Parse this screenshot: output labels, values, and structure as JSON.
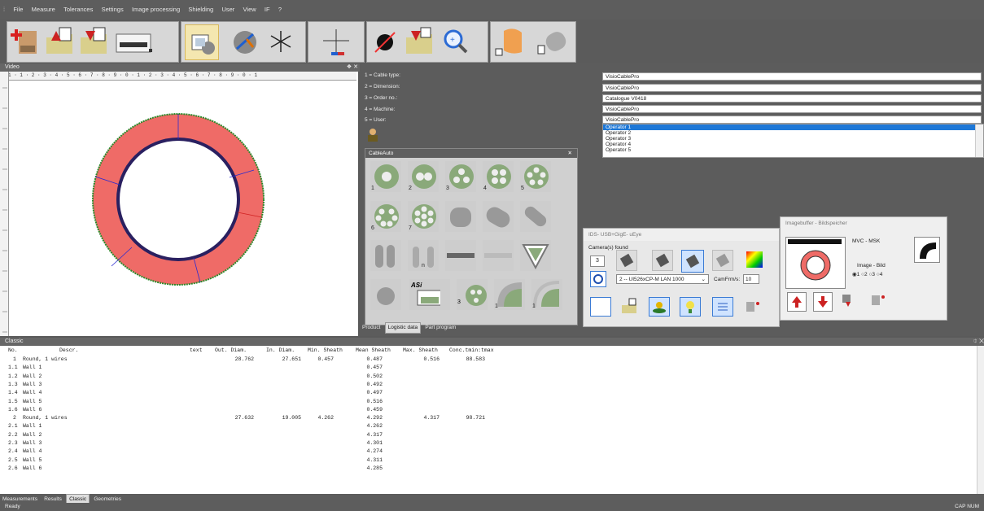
{
  "menu": [
    "File",
    "Measure",
    "Tolerances",
    "Settings",
    "Image processing",
    "Shielding",
    "User",
    "View",
    "IF",
    "?"
  ],
  "video": {
    "title": "Video",
    "pin": "❖ ✕",
    "ruler_top": "1 · 1 · 2 · 3 · 4 · 5 · 6 · 7 · 8 · 9 · 0 · 1 · 2 · 3 · 4 · 5 · 6 · 7 · 8 · 9 · 0 · 1"
  },
  "form": {
    "labels": [
      "1 = Cable type:",
      "2 = Dimension:",
      "3 = Order no.:",
      "4 = Machine:",
      "5 = User:"
    ],
    "values": [
      "VisioCablePro",
      "VisioCablePro",
      "Catalogue V0418",
      "VisioCablePro",
      "VisioCablePro"
    ],
    "operators": [
      "Operator 1",
      "Operator 2",
      "Operator 3",
      "Operator 4",
      "Operator 5"
    ]
  },
  "cableauto": {
    "title": "CableAuto",
    "close": "✕",
    "labels": [
      "1",
      "2",
      "3",
      "4",
      "5",
      "6",
      "7",
      "n",
      "1",
      "1"
    ]
  },
  "tabs": [
    "Product",
    "Logistic data",
    "Part program"
  ],
  "ids": {
    "title": "IDS- USB+GigE- uEye",
    "found_label": "Camera(s) found",
    "count": "3",
    "camera": "2 -- UI526xCP-M LAN 1000",
    "camfrm_label": "CamFrm/s:",
    "camfrm_value": "10"
  },
  "imgbuf": {
    "title": "Imagebuffer - Bildspeicher",
    "mvc": "MVC - MSK",
    "image_label": "Image - Bild",
    "options": [
      "1",
      "2",
      "3",
      "4"
    ]
  },
  "classic": {
    "title": "Classic",
    "headers": [
      "No.",
      "Descr.",
      "text",
      "Out. Diam.",
      "In. Diam.",
      "Min. Sheath",
      "Mean Sheath",
      "Max. Sheath",
      "Conc.tmin:tmax"
    ],
    "rows": [
      [
        "1",
        "Round, 1 wires",
        "",
        "28.762",
        "27.651",
        "0.457",
        "0.487",
        "0.516",
        "88.583"
      ],
      [
        "1.1",
        "Wall 1",
        "",
        "",
        "",
        "",
        "0.457",
        "",
        ""
      ],
      [
        "1.2",
        "Wall 2",
        "",
        "",
        "",
        "",
        "0.502",
        "",
        ""
      ],
      [
        "1.3",
        "Wall 3",
        "",
        "",
        "",
        "",
        "0.492",
        "",
        ""
      ],
      [
        "1.4",
        "Wall 4",
        "",
        "",
        "",
        "",
        "0.497",
        "",
        ""
      ],
      [
        "1.5",
        "Wall 5",
        "",
        "",
        "",
        "",
        "0.516",
        "",
        ""
      ],
      [
        "1.6",
        "Wall 6",
        "",
        "",
        "",
        "",
        "0.459",
        "",
        ""
      ],
      [
        "2",
        "Round, 1 wires",
        "",
        "27.632",
        "19.005",
        "4.262",
        "4.292",
        "4.317",
        "98.721"
      ],
      [
        "2.1",
        "Wall 1",
        "",
        "",
        "",
        "",
        "4.262",
        "",
        ""
      ],
      [
        "2.2",
        "Wall 2",
        "",
        "",
        "",
        "",
        "4.317",
        "",
        ""
      ],
      [
        "2.3",
        "Wall 3",
        "",
        "",
        "",
        "",
        "4.301",
        "",
        ""
      ],
      [
        "2.4",
        "Wall 4",
        "",
        "",
        "",
        "",
        "4.274",
        "",
        ""
      ],
      [
        "2.5",
        "Wall 5",
        "",
        "",
        "",
        "",
        "4.311",
        "",
        ""
      ],
      [
        "2.6",
        "Wall 6",
        "",
        "",
        "",
        "",
        "4.285",
        "",
        ""
      ]
    ]
  },
  "bottomtabs": [
    "Measurements",
    "Results",
    "Classic",
    "Geometries"
  ],
  "status": {
    "left": "Ready",
    "right": "CAP NUM"
  },
  "colors": {
    "ring": "#ef6b67",
    "accent": "#1e78d7",
    "panel": "#5c5c5c"
  }
}
